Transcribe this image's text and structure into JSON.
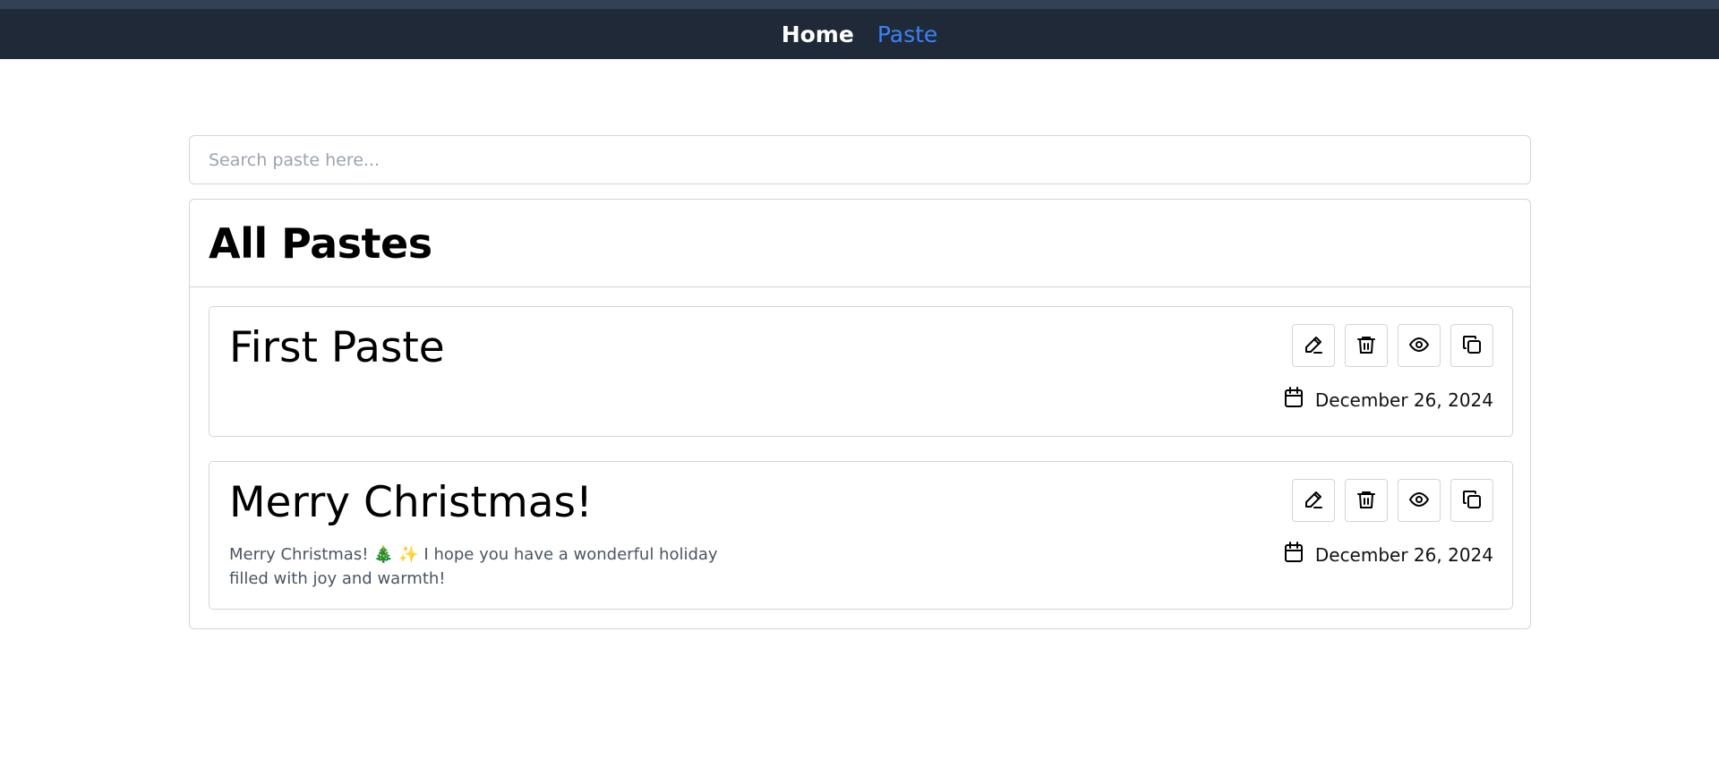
{
  "nav": {
    "home_label": "Home",
    "paste_label": "Paste",
    "active_color": "#3b82f6",
    "bar_color": "#1f2937"
  },
  "search": {
    "placeholder": "Search paste here...",
    "value": ""
  },
  "pastes_panel": {
    "title": "All Pastes",
    "items": [
      {
        "title": "First Paste",
        "content": "",
        "date": "December 26, 2024",
        "actions": [
          "edit-icon",
          "trash-icon",
          "eye-icon",
          "copy-icon"
        ]
      },
      {
        "title": "Merry Christmas!",
        "content": "Merry Christmas! 🎄 ✨ I hope you have a wonderful holiday filled with joy and warmth!",
        "date": "December 26, 2024",
        "actions": [
          "edit-icon",
          "trash-icon",
          "eye-icon",
          "copy-icon"
        ]
      }
    ]
  }
}
